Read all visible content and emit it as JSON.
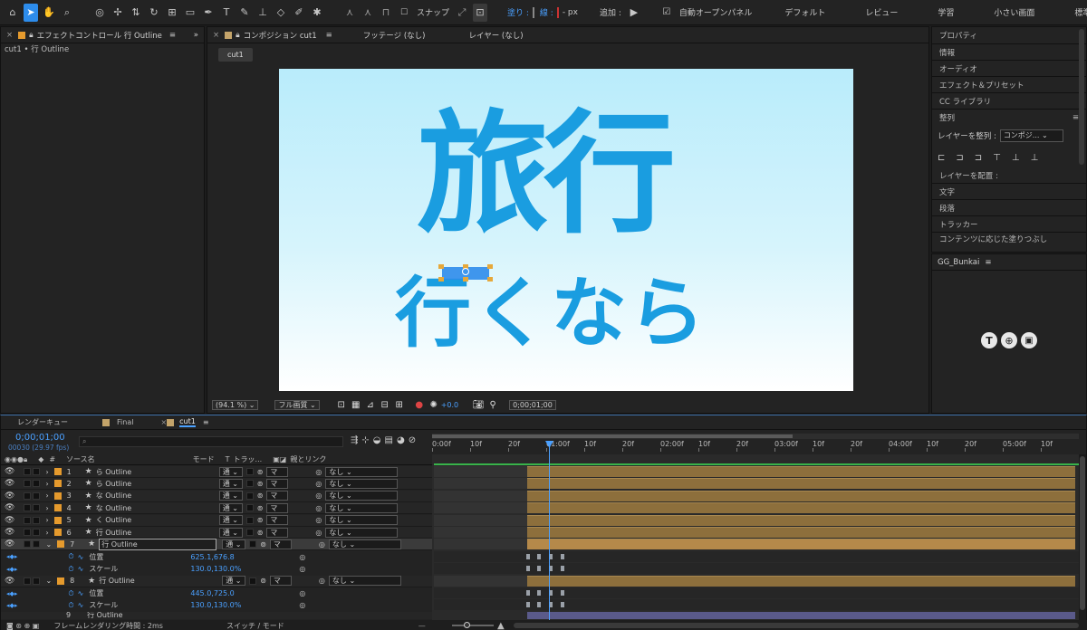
{
  "toolbar": {
    "snap_label": "スナップ",
    "fill_label": "塗り :",
    "stroke_label": "線 :",
    "stroke_value": "- px",
    "add_label": "追加 :",
    "auto_open_label": "自動オープンパネル",
    "workspaces": [
      "デフォルト",
      "レビュー",
      "学習",
      "小さい画面",
      "標準"
    ],
    "fill_color": "#2d8ceb"
  },
  "effect_panel": {
    "title": "エフェクトコントロール 行 Outline",
    "subtitle": "cut1 • 行 Outline"
  },
  "comp_panel": {
    "tab_title": "コンポジション cut1",
    "footage_tab": "フッテージ (なし)",
    "layer_tab": "レイヤー (なし)",
    "breadcrumb": "cut1",
    "canvas_text_line1": "旅行",
    "canvas_text_line2": "行くなら",
    "zoom": "(94.1 %)",
    "quality": "フル画質",
    "exposure": "+0.0",
    "timecode": "0;00;01;00"
  },
  "right_panel": {
    "items": [
      "プロパティ",
      "情報",
      "オーディオ",
      "エフェクト＆プリセット",
      "CC ライブラリ"
    ],
    "align_title": "整列",
    "align_to_label": "レイヤーを整列 :",
    "align_to_value": "コンポジ...",
    "distribute_label": "レイヤーを配置 :",
    "items2": [
      "文字",
      "段落",
      "トラッカー",
      "コンテンツに応じた塗りつぶし"
    ],
    "gg_title": "GG_Bunkai"
  },
  "timeline": {
    "tabs": [
      "レンダーキュー",
      "Final",
      "cut1"
    ],
    "current_time": "0;00;01;00",
    "frame_info": "00030 (29.97 fps)",
    "columns": {
      "name": "ソース名",
      "mode": "モード",
      "t": "T",
      "track": "トラッ...",
      "parent": "親とリンク",
      "num": "#"
    },
    "ruler": [
      "0:00f",
      "10f",
      "20f",
      "01:00f",
      "10f",
      "20f",
      "02:00f",
      "10f",
      "20f",
      "03:00f",
      "10f",
      "20f",
      "04:00f",
      "10f",
      "20f",
      "05:00f",
      "10f"
    ],
    "layers": [
      {
        "num": "1",
        "name": "ら Outline",
        "mode": "通",
        "track": "マ",
        "parent": "なし"
      },
      {
        "num": "2",
        "name": "ら Outline",
        "mode": "通",
        "track": "マ",
        "parent": "なし"
      },
      {
        "num": "3",
        "name": "な Outline",
        "mode": "通",
        "track": "マ",
        "parent": "なし"
      },
      {
        "num": "4",
        "name": "な Outline",
        "mode": "通",
        "track": "マ",
        "parent": "なし"
      },
      {
        "num": "5",
        "name": "く Outline",
        "mode": "通",
        "track": "マ",
        "parent": "なし"
      },
      {
        "num": "6",
        "name": "行 Outline",
        "mode": "通",
        "track": "マ",
        "parent": "なし"
      },
      {
        "num": "7",
        "name": "行 Outline",
        "mode": "通",
        "track": "マ",
        "parent": "なし"
      }
    ],
    "layer7_props": [
      {
        "name": "位置",
        "value": "625.1,676.8"
      },
      {
        "name": "スケール",
        "value": "130.0,130.0%"
      }
    ],
    "layer8": {
      "num": "8",
      "name": "行 Outline",
      "mode": "通",
      "track": "マ",
      "parent": "なし"
    },
    "layer8_props": [
      {
        "name": "位置",
        "value": "445.0,725.0"
      },
      {
        "name": "スケール",
        "value": "130.0,130.0%"
      }
    ],
    "layer9": {
      "num": "9",
      "name": "行 Outline"
    },
    "footer_left": "フレームレンダリング時間 : 2ms",
    "footer_mid": "スイッチ / モード"
  }
}
